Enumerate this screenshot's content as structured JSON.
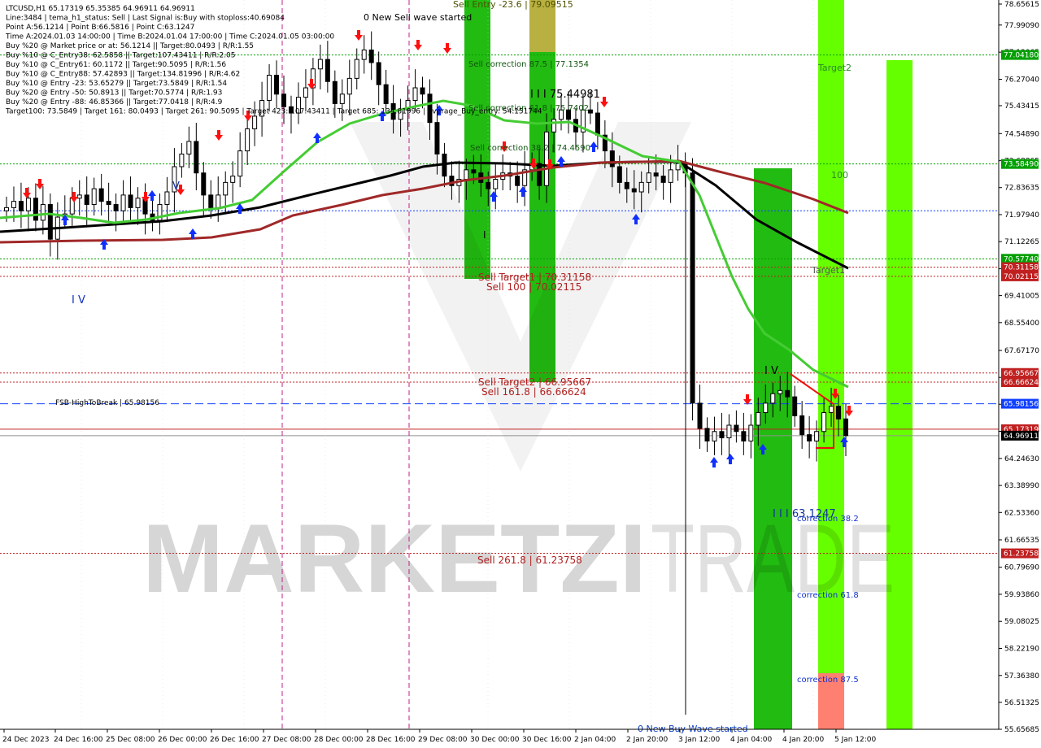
{
  "header": {
    "lines": [
      "LTCUSD,H1  65.17319 65.35385 64.96911 64.96911",
      "Line:3484 | tema_h1_status: Sell | Last Signal is:Buy with stoploss:40.69084",
      "Point A:56.1214 | Point B:66.5816 | Point C:63.1247",
      "Time A:2024.01.03 14:00:00 | Time B:2024.01.04 17:00:00 | Time C:2024.01.05 03:00:00",
      "Buy %20 @ Market price or at: 56.1214 || Target:80.0493 | R/R:1.55",
      "Buy %10 @ C_Entry38: 62.5858 || Target:107.43411 | R/R:2.05",
      "Buy %10 @ C_Entry61: 60.1172 || Target:90.5095 | R/R:1.56",
      "Buy %10 @ C_Entry88: 57.42893 || Target:134.81996 | R/R:4.62",
      "Buy %10 @ Entry -23: 53.65279 || Target:73.5849 | R/R:1.54",
      "Buy %20 @ Entry -50: 50.8913 || Target:70.5774 | R/R:1.93",
      "Buy %20 @ Entry -88: 46.85366 || Target:77.0418 | R/R:4.9",
      "Target100: 73.5849 | Target 161: 80.0493 | Target 261: 90.5095 | Target 423: 107.43411 | Target 685: 134.81996 | average_Buy_entry: 54.151744"
    ]
  },
  "price_axis": {
    "ticks": [
      "78.65615",
      "77.99090",
      "77.13065",
      "76.27040",
      "75.43415",
      "74.54890",
      "73.68865",
      "72.83635",
      "71.97940",
      "71.12265",
      "70.26140",
      "69.41005",
      "68.55400",
      "67.67170",
      "66.81685",
      "65.96465",
      "65.10640",
      "64.24630",
      "63.38990",
      "62.53360",
      "61.66535",
      "60.79690",
      "59.93860",
      "59.08025",
      "58.22190",
      "57.36380",
      "56.51325",
      "55.65685"
    ]
  },
  "time_axis": {
    "ticks": [
      "24 Dec 2023",
      "24 Dec 16:00",
      "25 Dec 08:00",
      "26 Dec 00:00",
      "26 Dec 16:00",
      "27 Dec 08:00",
      "28 Dec 00:00",
      "28 Dec 16:00",
      "29 Dec 08:00",
      "30 Dec 00:00",
      "30 Dec 16:00",
      "2 Jan 04:00",
      "2 Jan 20:00",
      "3 Jan 12:00",
      "4 Jan 04:00",
      "4 Jan 20:00",
      "5 Jan 12:00"
    ]
  },
  "price_tags": [
    {
      "price": 77.0418,
      "text": "77.04180",
      "color": "#00a000"
    },
    {
      "price": 73.5849,
      "text": "73.58490",
      "color": "#00a000"
    },
    {
      "price": 70.5774,
      "text": "70.57740",
      "color": "#00a000"
    },
    {
      "price": 70.31158,
      "text": "70.31158",
      "color": "#c02020"
    },
    {
      "price": 70.02115,
      "text": "70.02115",
      "color": "#c02020"
    },
    {
      "price": 66.95667,
      "text": "66.95667",
      "color": "#c02020"
    },
    {
      "price": 66.66624,
      "text": "66.66624",
      "color": "#c02020"
    },
    {
      "price": 65.98156,
      "text": "65.98156",
      "color": "#1040ff"
    },
    {
      "price": 65.17319,
      "text": "65.17319",
      "color": "#c02020"
    },
    {
      "price": 64.96911,
      "text": "64.96911",
      "color": "#000000"
    },
    {
      "price": 61.23758,
      "text": "61.23758",
      "color": "#c02020"
    }
  ],
  "level_labels": {
    "sell_entry": "Sell Entry -23.6 | 79.09515",
    "sell_corr_875": "Sell correction 87.5 | 77.1354",
    "sell_corr_618": "Sell correction 61.8 | 75.7402",
    "sell_corr_382": "Sell correction 38.2 | 74.4590",
    "iii_high": "I I I  75.44981",
    "sell_target1": "Sell Target1 | 70.31158",
    "sell_100": "Sell 100 | 70.02115",
    "sell_target2": "Sell Target2 | 66.95667",
    "sell_1618": "Sell 161.8 | 66.66624",
    "fsb": "FSB-HighToBreak  |  65.98156",
    "sell_2618": "Sell  261.8 | 61.23758",
    "new_sell_wave": "0 New Sell wave started",
    "new_buy_wave": "0 New Buy Wave started",
    "target2": "Target2",
    "target1": "Target1",
    "hundred": "100",
    "iii_low": "I I I  63.1247",
    "corr_382": "correction 38.2",
    "corr_618": "correction 61.8",
    "corr_875": "correction 87.5",
    "wave_iv_left": "I V",
    "wave_iv_right": "I V",
    "wave_v": "V",
    "wave_i": "I"
  },
  "watermark": {
    "left": "MARKETZI",
    "right": "TRADE"
  },
  "colors": {
    "bg": "#ffffff",
    "candle": "#000000",
    "ma_black": "#000000",
    "ma_red": "#a02828",
    "ma_green": "#44cc33",
    "zone_green": "#22bb11",
    "zone_lime": "#66ff00",
    "zone_olive": "#b8b040",
    "zone_salmon": "#ff8070",
    "buy_arrow": "#1030ff",
    "sell_arrow": "#ff1010"
  },
  "chart_data": {
    "type": "candlestick",
    "symbol": "LTCUSD,H1",
    "ylim": [
      55.65685,
      78.65615
    ],
    "series": [
      {
        "name": "candles",
        "close": [
          72.2,
          72.4,
          72.1,
          72.5,
          71.8,
          72.3,
          71.2,
          71.9,
          72.0,
          72.5,
          72.6,
          72.3,
          72.8,
          72.4,
          72.3,
          72.1,
          72.6,
          72.2,
          72.5,
          72.0,
          71.8,
          72.3,
          72.7,
          73.5,
          73.9,
          74.3,
          73.3,
          72.6,
          72.2,
          72.6,
          73.0,
          73.2,
          74.0,
          74.7,
          75.1,
          75.6,
          76.4,
          75.8,
          75.4,
          75.2,
          75.7,
          76.0,
          76.6,
          76.9,
          76.2,
          75.5,
          75.8,
          76.3,
          76.9,
          77.2,
          76.8,
          76.1,
          75.5,
          75.0,
          75.3,
          75.6,
          76.0,
          75.8,
          74.9,
          73.9,
          73.2,
          72.9,
          73.1,
          73.4,
          73.3,
          73.0,
          72.8,
          73.1,
          73.3,
          73.2,
          72.9,
          73.4,
          73.6,
          72.9,
          74.6,
          75.0,
          75.3,
          75.0,
          74.6,
          75.3,
          75.2,
          74.5,
          74.0,
          73.5,
          73.0,
          72.8,
          72.7,
          73.0,
          73.3,
          73.2,
          73.0,
          73.4,
          73.6,
          73.3,
          66.0,
          65.2,
          64.8,
          65.1,
          64.9,
          65.3,
          65.1,
          64.8,
          65.3,
          65.7,
          66.0,
          66.3,
          66.4,
          66.2,
          65.6,
          65.0,
          64.8,
          65.1,
          65.7,
          65.9,
          65.5,
          64.97
        ]
      }
    ],
    "levels": [
      77.0418,
      73.5849,
      70.5774,
      70.31158,
      70.02115,
      66.95667,
      66.66624,
      65.98156,
      65.17319,
      61.23758
    ],
    "buy_signals": 16,
    "sell_signals": 18
  }
}
